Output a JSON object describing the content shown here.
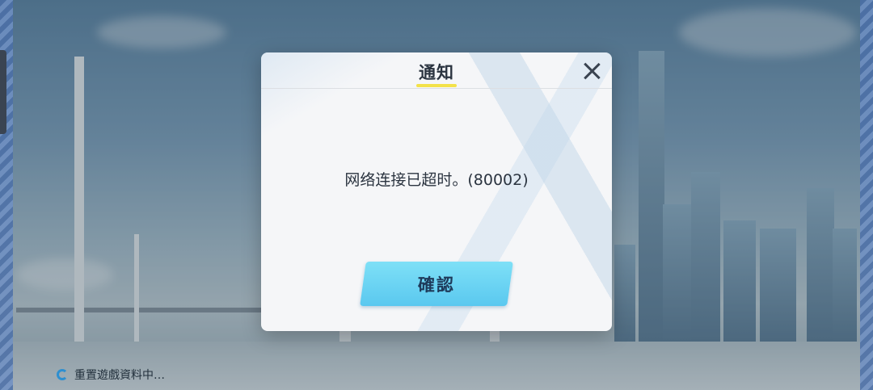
{
  "dialog": {
    "title": "通知",
    "message": "网络连接已超时。(80002)",
    "confirm_label": "確認",
    "close_icon": "close-icon"
  },
  "status": {
    "text": "重置遊戲資料中…",
    "icon": "loading-spinner-icon"
  },
  "colors": {
    "confirm_button": "#5ac8ef",
    "title_underline": "#f3e24a",
    "dialog_bg": "#f5f6f8"
  }
}
